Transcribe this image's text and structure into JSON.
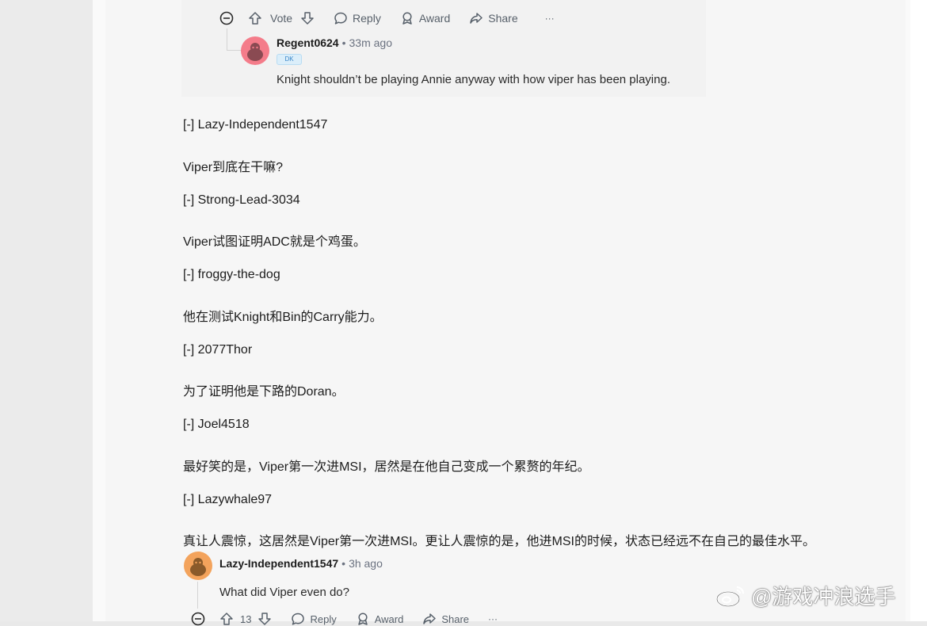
{
  "top_comment_actions": {
    "vote_label": "Vote",
    "reply_label": "Reply",
    "award_label": "Award",
    "share_label": "Share",
    "more_label": "···"
  },
  "reply_comment": {
    "username": "Regent0624",
    "separator": "•",
    "time": "33m ago",
    "flair": "DK",
    "text": "Knight shouldn’t be playing Annie anyway with how viper has been playing."
  },
  "lines": [
    "[-] Lazy-Independent1547",
    "Viper到底在干嘛?",
    "[-] Strong-Lead-3034",
    "Viper试图证明ADC就是个鸡蛋。",
    "[-] froggy-the-dog",
    "他在测试Knight和Bin的Carry能力。",
    "[-] 2077Thor",
    "为了证明他是下路的Doran。",
    "[-] Joel4518",
    "最好笑的是，Viper第一次进MSI，居然是在他自己变成一个累赘的年纪。",
    "[-] Lazywhale97",
    "真让人震惊，这居然是Viper第一次进MSI。更让人震惊的是，他进MSI的时候，状态已经远不在自己的最佳水平。"
  ],
  "bottom_comment": {
    "username": "Lazy-Independent1547",
    "separator": "•",
    "time": "3h ago",
    "text": "What did Viper even do?",
    "vote_count": "13",
    "reply_label": "Reply",
    "award_label": "Award",
    "share_label": "Share",
    "more_label": "···"
  },
  "watermark": {
    "text": "@游戏冲浪选手",
    "icon": "weibo-icon"
  },
  "colors": {
    "page_bg": "#fafafa",
    "gutter_bg": "#ebebeb",
    "action_gray": "#57606a",
    "avatar_pink": "#f47c8a",
    "avatar_orange": "#f3a35c",
    "flair_blue": "#3a86c8"
  }
}
